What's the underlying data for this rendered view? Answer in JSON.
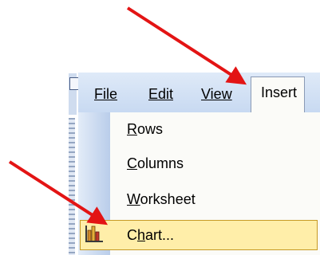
{
  "menubar": {
    "file": "File",
    "edit": "Edit",
    "view": "View",
    "insert": "Insert"
  },
  "insert_menu": {
    "items": [
      {
        "pre": "",
        "u": "R",
        "post": "ows"
      },
      {
        "pre": "",
        "u": "C",
        "post": "olumns"
      },
      {
        "pre": "",
        "u": "W",
        "post": "orksheet"
      },
      {
        "pre": "C",
        "u": "h",
        "post": "art..."
      }
    ]
  },
  "colors": {
    "arrow": "#e31414",
    "highlight_fill": "#ffeea9",
    "highlight_border": "#c79a24"
  },
  "icons": {
    "chart": "bar-chart-icon"
  }
}
